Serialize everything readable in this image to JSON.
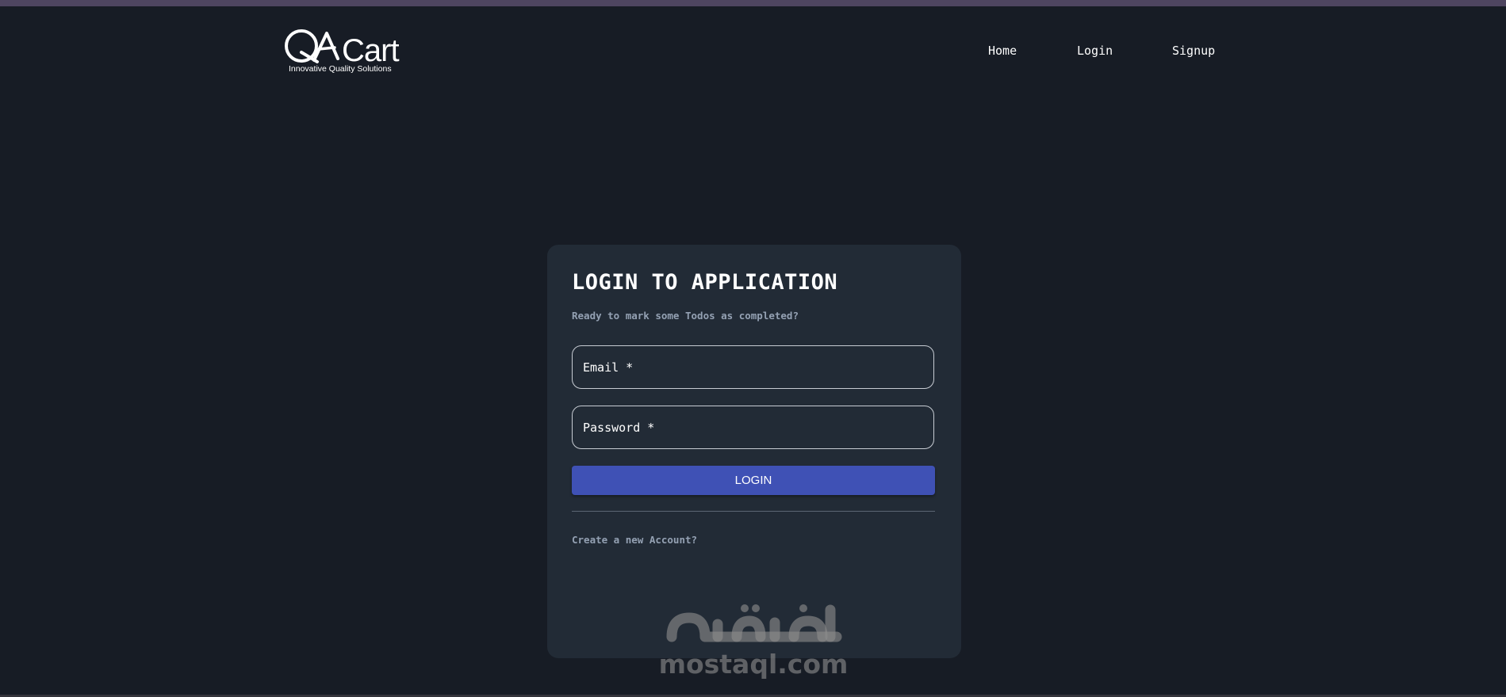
{
  "header": {
    "logo_text": "Cart",
    "logo_tagline": "Innovative Quality Solutions",
    "nav": [
      {
        "label": "Home"
      },
      {
        "label": "Login"
      },
      {
        "label": "Signup"
      }
    ]
  },
  "login_card": {
    "title": "LOGIN TO APPLICATION",
    "subtitle": "Ready to mark some Todos as completed?",
    "email_label": "Email *",
    "password_label": "Password *",
    "login_button_label": "LOGIN",
    "create_account_link": "Create a new Account?"
  },
  "watermark": {
    "text": "mostaql.com"
  },
  "colors": {
    "background": "#171c25",
    "card": "#222b36",
    "accent": "#3f51b5",
    "muted_text": "#94a1b3"
  },
  "icons": {
    "logo_mark": "qa-logo-icon"
  }
}
